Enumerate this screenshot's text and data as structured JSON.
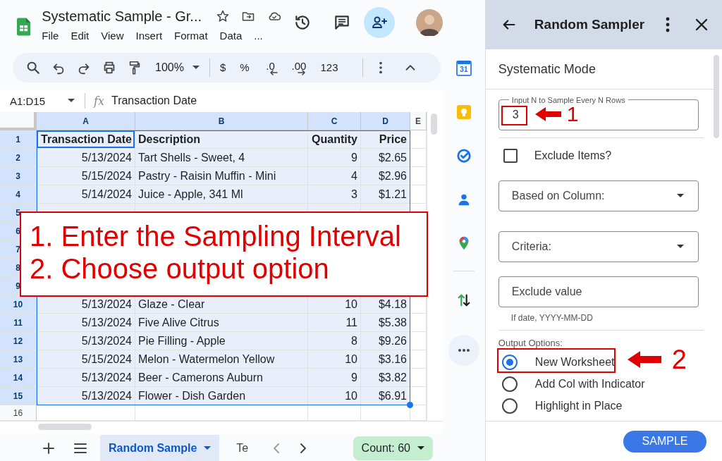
{
  "document": {
    "title": "Systematic Sample - Gr...",
    "menus": [
      "File",
      "Edit",
      "View",
      "Insert",
      "Format",
      "Data",
      "..."
    ]
  },
  "toolbar": {
    "zoom": "100%",
    "text_buttons": [
      "$",
      "%",
      ".0",
      ".00",
      "123"
    ]
  },
  "formula_bar": {
    "name_box": "A1:D15",
    "fx": "fx",
    "value": "Transaction Date"
  },
  "sheet": {
    "columns": [
      {
        "label": "A",
        "selected": true
      },
      {
        "label": "B",
        "selected": true
      },
      {
        "label": "C",
        "selected": true
      },
      {
        "label": "D",
        "selected": true
      },
      {
        "label": "E",
        "selected": false
      }
    ],
    "rows": [
      {
        "number": "1",
        "selected": true,
        "cells": [
          "Transaction Date",
          "Description",
          "Quantity",
          "Price"
        ]
      },
      {
        "number": "2",
        "selected": true,
        "cells": [
          "5/13/2024",
          "Tart Shells - Sweet, 4",
          "9",
          "$2.65"
        ]
      },
      {
        "number": "3",
        "selected": true,
        "cells": [
          "5/15/2024",
          "Pastry - Raisin Muffin - Mini",
          "4",
          "$2.96"
        ]
      },
      {
        "number": "4",
        "selected": true,
        "cells": [
          "5/14/2024",
          "Juice - Apple, 341 Ml",
          "3",
          "$1.21"
        ]
      },
      {
        "number": "5",
        "selected": true
      },
      {
        "number": "6",
        "selected": true
      },
      {
        "number": "7",
        "selected": true
      },
      {
        "number": "8",
        "selected": true
      },
      {
        "number": "9",
        "selected": true
      },
      {
        "number": "10",
        "selected": true,
        "cells": [
          "5/13/2024",
          "Glaze - Clear",
          "10",
          "$4.18"
        ]
      },
      {
        "number": "11",
        "selected": true,
        "cells": [
          "5/13/2024",
          "Five Alive Citrus",
          "11",
          "$5.38"
        ]
      },
      {
        "number": "12",
        "selected": true,
        "cells": [
          "5/13/2024",
          "Pie Filling - Apple",
          "8",
          "$9.26"
        ]
      },
      {
        "number": "13",
        "selected": true,
        "cells": [
          "5/15/2024",
          "Melon - Watermelon Yellow",
          "10",
          "$3.16"
        ]
      },
      {
        "number": "14",
        "selected": true,
        "cells": [
          "5/13/2024",
          "Beer - Camerons Auburn",
          "9",
          "$3.82"
        ]
      },
      {
        "number": "15",
        "selected": true,
        "cells": [
          "5/13/2024",
          "Flower - Dish Garden",
          "10",
          "$6.91"
        ]
      },
      {
        "number": "16",
        "selected": false
      }
    ]
  },
  "sheet_tabs": [
    {
      "label": "Random Sample",
      "selected": true
    },
    {
      "label": "Te",
      "selected": false
    }
  ],
  "status": {
    "count": "Count: 60"
  },
  "side_apps": {
    "calendar_day": "31"
  },
  "sidebar": {
    "title": "Random Sampler",
    "section": "Systematic Mode",
    "interval_field": {
      "label": "Input N to Sample Every N Rows",
      "value": "3"
    },
    "exclude": {
      "label": "Exclude Items?",
      "checked": false
    },
    "column_select": {
      "label": "Based on Column:"
    },
    "criteria_select": {
      "label": "Criteria:"
    },
    "exclude_value": {
      "placeholder": "Exclude value",
      "hint": "If date, YYYY-MM-DD"
    },
    "output_label": "Output Options:",
    "output_options": [
      {
        "label": "New Worksheet",
        "selected": true
      },
      {
        "label": "Add Col with Indicator",
        "selected": false
      },
      {
        "label": "Highlight in Place",
        "selected": false
      }
    ],
    "button": "SAMPLE"
  },
  "annotations": {
    "callout": [
      "1. Enter the Sampling Interval",
      "2. Choose output option"
    ],
    "markers": [
      "1",
      "2"
    ]
  }
}
